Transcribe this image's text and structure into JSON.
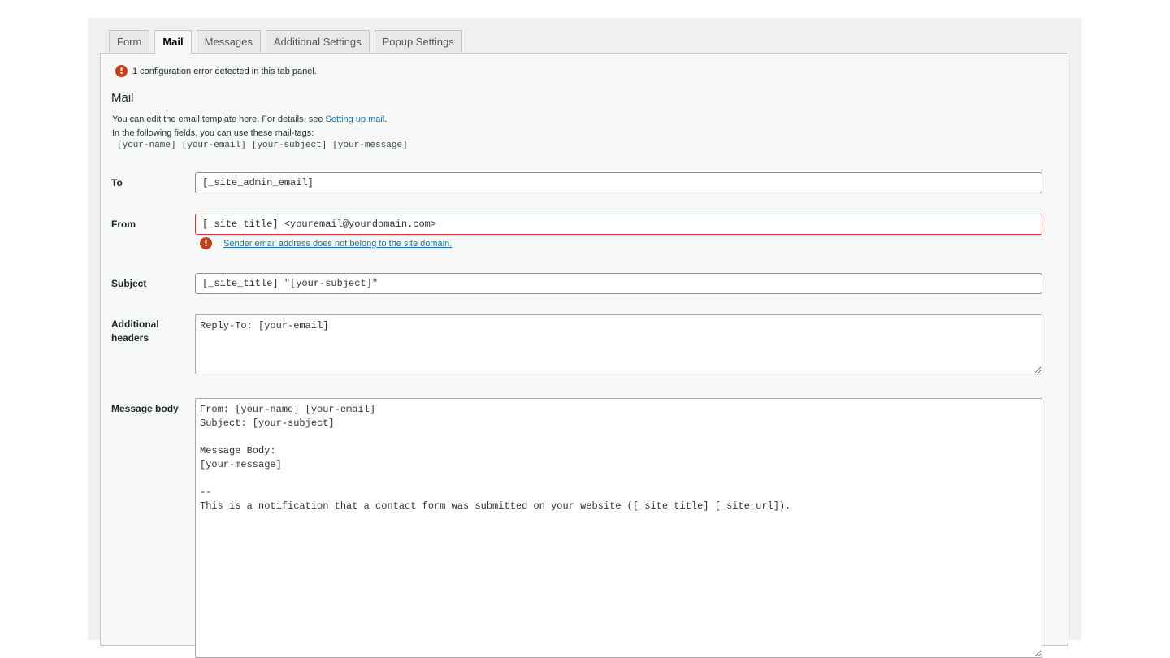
{
  "tabs": [
    {
      "label": "Form"
    },
    {
      "label": "Mail"
    },
    {
      "label": "Messages"
    },
    {
      "label": "Additional Settings"
    },
    {
      "label": "Popup Settings"
    }
  ],
  "notice": {
    "icon": "exclamation-icon",
    "text": "1 configuration error detected in this tab panel."
  },
  "section": {
    "title": "Mail",
    "desc_line1_prefix": "You can edit the email template here. For details, see ",
    "desc_link": "Setting up mail",
    "desc_line1_suffix": ".",
    "desc_line2": "In the following fields, you can use these mail-tags:",
    "mail_tags": [
      "[your-name]",
      "[your-email]",
      "[your-subject]",
      "[your-message]"
    ]
  },
  "fields": {
    "to": {
      "label": "To",
      "value": "[_site_admin_email]"
    },
    "from": {
      "label": "From",
      "value": "[_site_title] <youremail@yourdomain.com>",
      "error": "Sender email address does not belong to the site domain."
    },
    "subject": {
      "label": "Subject",
      "value": "[_site_title] \"[your-subject]\""
    },
    "headers": {
      "label_line1": "Additional",
      "label_line2": "headers",
      "value": "Reply-To: [your-email]"
    },
    "body": {
      "label": "Message body",
      "value": "From: [your-name] [your-email]\nSubject: [your-subject]\n\nMessage Body:\n[your-message]\n\n-- \nThis is a notification that a contact form was submitted on your website ([_site_title] [_site_url])."
    }
  },
  "colors": {
    "error": "#c5401d",
    "link": "#2271b1",
    "active_tab": "#f6f7f7"
  }
}
